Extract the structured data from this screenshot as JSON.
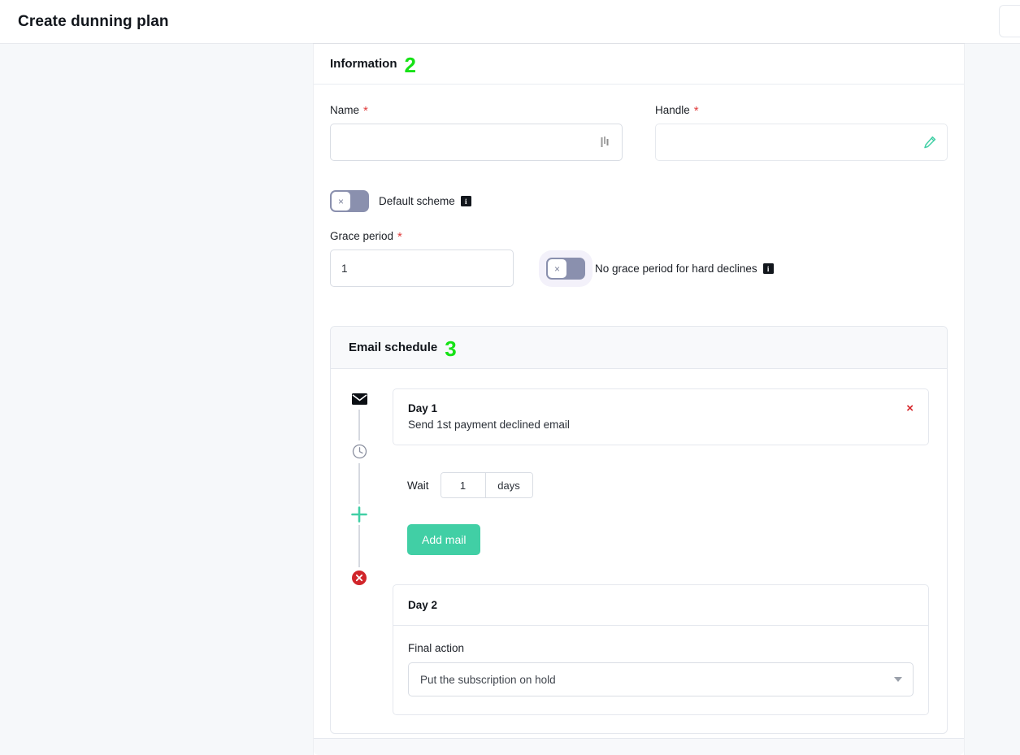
{
  "header": {
    "title": "Create dunning plan"
  },
  "information_section": {
    "title": "Information",
    "step": "2",
    "name_field": {
      "label": "Name",
      "required_mark": "*",
      "value": "",
      "placeholder": "",
      "icon": "text-cursor-icon"
    },
    "handle_field": {
      "label": "Handle",
      "required_mark": "*",
      "value": "",
      "placeholder": "",
      "icon": "pencil-icon"
    },
    "default_scheme_toggle": {
      "label": "Default scheme",
      "state": "off",
      "knob_glyph": "×",
      "info_glyph": "i"
    },
    "grace_period_field": {
      "label": "Grace period",
      "required_mark": "*",
      "value": "1"
    },
    "hard_declines_toggle": {
      "label": "No grace period for hard declines",
      "state": "off",
      "knob_glyph": "×",
      "info_glyph": "i",
      "focused": true
    }
  },
  "email_schedule_section": {
    "title": "Email schedule",
    "step": "3",
    "day1": {
      "timeline_icon": "envelope-icon",
      "title": "Day 1",
      "subtitle": "Send 1st payment declined email",
      "remove_label": "×"
    },
    "wait": {
      "timeline_icon": "clock-icon",
      "label": "Wait",
      "value": "1",
      "unit": "days"
    },
    "add_mail": {
      "timeline_icon": "plus-icon",
      "label": "Add mail"
    },
    "day2": {
      "timeline_icon": "cancel-circle-icon",
      "title": "Day 2",
      "final_action_label": "Final action",
      "final_action_value": "Put the subscription on hold"
    }
  },
  "colors": {
    "step_badge_green": "#16e216",
    "accent_teal": "#41cfa5",
    "danger_red": "#d6262b",
    "toggle_track": "#8a90ae",
    "page_bg": "#f6f8fa"
  }
}
